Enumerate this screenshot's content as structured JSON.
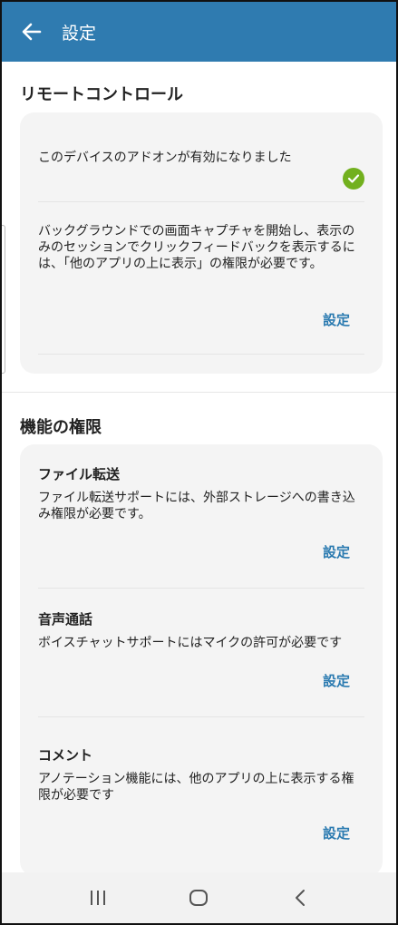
{
  "appbar": {
    "title": "設定"
  },
  "remote": {
    "heading": "リモートコントロール",
    "addon_status": "このデバイスのアドオンが有効になりました",
    "overlay_desc": "バックグラウンドでの画面キャプチャを開始し、表示のみのセッションでクリックフィードバックを表示するには、「他のアプリの上に表示」の権限が必要です。",
    "settings_label": "設定"
  },
  "permissions": {
    "heading": "機能の権限",
    "items": [
      {
        "title": "ファイル転送",
        "desc": "ファイル転送サポートには、外部ストレージへの書き込み権限が必要です。",
        "settings_label": "設定"
      },
      {
        "title": "音声通話",
        "desc": "ボイスチャットサポートにはマイクの許可が必要です",
        "settings_label": "設定"
      },
      {
        "title": "コメント",
        "desc": "アノテーション機能には、他のアプリの上に表示する権限が必要です",
        "settings_label": "設定"
      }
    ]
  },
  "icons": {
    "back": "arrow-left-icon",
    "status": "check-circle-icon",
    "nav": [
      "recent-apps-icon",
      "home-icon",
      "back-chevron-icon"
    ]
  },
  "colors": {
    "appbar": "#2f7bb0",
    "accent_text": "#2a7ab0",
    "check": "#72b01e",
    "card": "#f4f4f4"
  }
}
